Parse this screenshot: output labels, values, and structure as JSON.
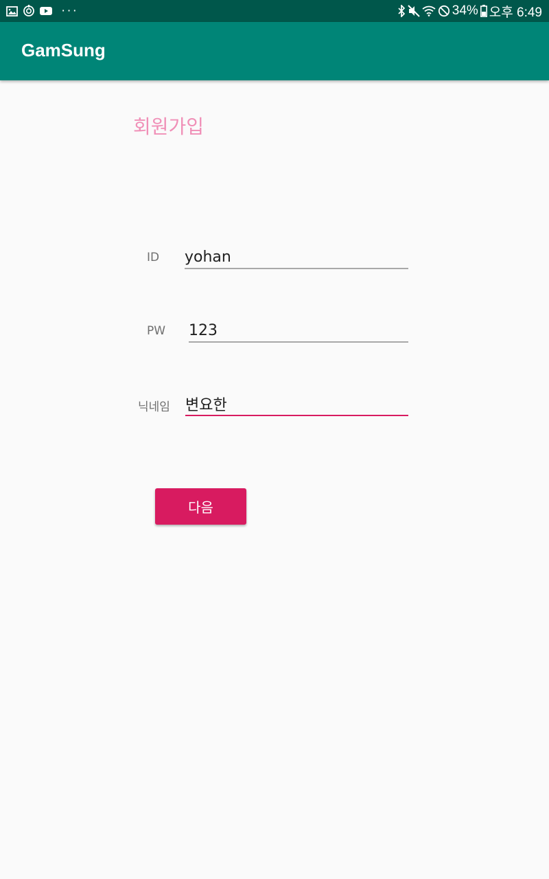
{
  "status_bar": {
    "left_icons": [
      "gallery-icon",
      "sync-icon",
      "youtube-icon"
    ],
    "more_dots": "···",
    "right_icons": [
      "bluetooth-icon",
      "mute-icon",
      "wifi-icon",
      "do-not-disturb-icon",
      "battery-icon"
    ],
    "battery": "34%",
    "time": "오후 6:49"
  },
  "app_bar": {
    "title": "GamSung",
    "color": "#008577",
    "status_color": "#00574b"
  },
  "signup": {
    "title": "회원가입",
    "fields": [
      {
        "label": "ID",
        "value": "yohan"
      },
      {
        "label": "PW",
        "value": "123"
      },
      {
        "label": "닉네임",
        "value": "변요한"
      }
    ],
    "next_label": "다음",
    "accent_color": "#d81b60"
  }
}
